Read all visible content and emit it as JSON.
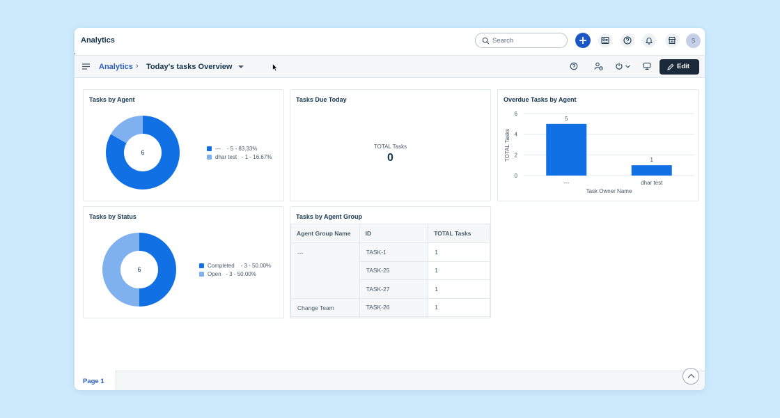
{
  "app": {
    "title": "Analytics"
  },
  "search": {
    "placeholder": "Search"
  },
  "user": {
    "avatar_initial": "S"
  },
  "icons": {
    "search": "search-icon",
    "add": "plus-icon",
    "contacts": "contact-card-icon",
    "help": "help-icon",
    "notifications": "bell-icon",
    "marketplace": "store-icon",
    "menu": "hamburger-icon",
    "schedule": "user-clock-icon",
    "power": "power-icon",
    "present": "monitor-icon",
    "edit": "pencil-icon",
    "scroll_top": "chevron-up-icon"
  },
  "breadcrumb": {
    "root": "Analytics",
    "separator": "›",
    "current": "Today's tasks Overview"
  },
  "toolbar": {
    "edit_label": "Edit"
  },
  "colors": {
    "primary": "#1170e4",
    "secondary": "#7fb1ef",
    "accent": "#2c5cc5",
    "dark": "#1b2a3a"
  },
  "widgets": {
    "tasks_by_agent": {
      "title": "Tasks by Agent"
    },
    "tasks_due_today": {
      "title": "Tasks Due Today",
      "total_label": "TOTAL Tasks",
      "total_value": "0"
    },
    "overdue_by_agent": {
      "title": "Overdue Tasks by Agent"
    },
    "tasks_by_status": {
      "title": "Tasks by Status"
    },
    "tasks_by_group": {
      "title": "Tasks by Agent Group",
      "columns": [
        "Agent Group Name",
        "ID",
        "TOTAL Tasks"
      ],
      "groups": [
        {
          "name": "---",
          "rows": [
            {
              "id": "TASK-1",
              "total": "1"
            },
            {
              "id": "TASK-25",
              "total": "1"
            },
            {
              "id": "TASK-27",
              "total": "1"
            }
          ]
        },
        {
          "name": "Change Team",
          "rows": [
            {
              "id": "TASK-26",
              "total": "1"
            }
          ]
        }
      ]
    }
  },
  "chart_data": [
    {
      "type": "pie",
      "title": "Tasks by Agent",
      "center_label": "6",
      "slices": [
        {
          "label": "---",
          "value": 5,
          "legend_text": "- 5 - 83.33%",
          "color": "#1170e4"
        },
        {
          "label": "dhar test",
          "value": 1,
          "legend_text": "- 1 - 16.67%",
          "color": "#7fb1ef"
        }
      ]
    },
    {
      "type": "bar",
      "title": "Overdue Tasks by Agent",
      "categories": [
        "---",
        "dhar test"
      ],
      "values": [
        5,
        1
      ],
      "data_labels": [
        "5",
        "1"
      ],
      "xlabel": "Task Owner Name",
      "ylabel": "TOTAL Tasks",
      "ylim": [
        0,
        6
      ],
      "yticks": [
        "0",
        "2",
        "4",
        "6"
      ],
      "grid": true,
      "color": "#1170e4"
    },
    {
      "type": "pie",
      "title": "Tasks by Status",
      "center_label": "6",
      "slices": [
        {
          "label": "Completed",
          "value": 3,
          "legend_text": "- 3 - 50.00%",
          "color": "#1170e4"
        },
        {
          "label": "Open",
          "value": 3,
          "legend_text": "- 3 - 50.00%",
          "color": "#7fb1ef"
        }
      ]
    }
  ],
  "footer": {
    "page_tab": "Page 1"
  }
}
